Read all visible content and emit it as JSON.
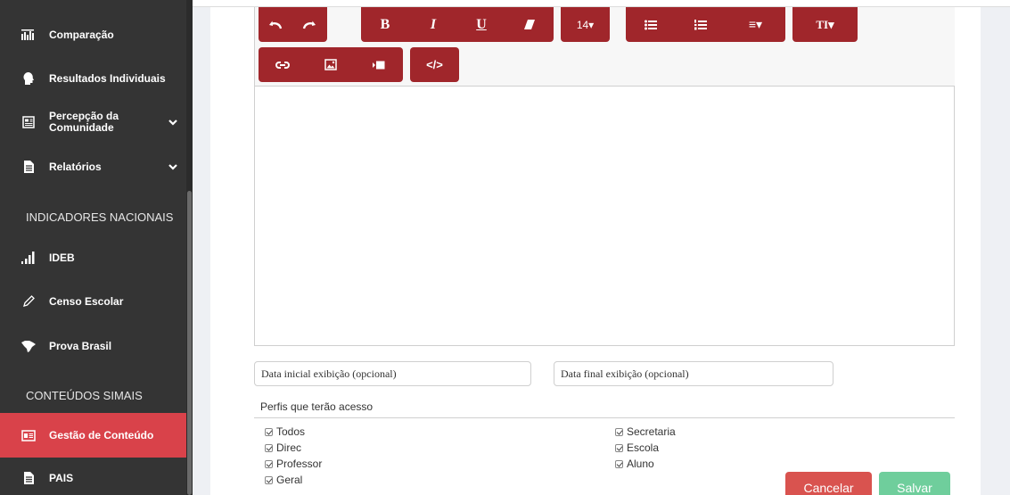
{
  "sidebar": {
    "items": [
      {
        "label": "Comparação",
        "icon": "bar-chart-icon"
      },
      {
        "label": "Resultados Individuais",
        "icon": "person-head-icon"
      },
      {
        "label_line1": "Percepção da",
        "label_line2": "Comunidade",
        "icon": "newspaper-icon"
      },
      {
        "label": "Relatórios",
        "icon": "document-icon"
      },
      {
        "label": "IDEB",
        "icon": "signal-bars-icon"
      },
      {
        "label": "Censo Escolar",
        "icon": "pencil-icon"
      },
      {
        "label": "Prova Brasil",
        "icon": "brazil-map-icon"
      },
      {
        "label": "Gestão de Conteúdo",
        "icon": "id-card-icon"
      },
      {
        "label": "PAIS",
        "icon": "document-icon"
      }
    ],
    "sections": {
      "nacionais": "INDICADORES NACIONAIS",
      "simais": "CONTEÚDOS SIMAIS"
    },
    "active_color": "#d9424a"
  },
  "toolbar": {
    "bold": "B",
    "italic": "I",
    "underline": "U",
    "font_size": "14▾",
    "align": "≡▾",
    "text_height": "TI▾",
    "code": "</>",
    "accent_color": "#a0262b"
  },
  "form": {
    "date_start_placeholder": "Data inicial exibição (opcional)",
    "date_end_placeholder": "Data final exibição (opcional)",
    "perfis_label": "Perfis que terão acesso",
    "profiles_left": [
      "Todos",
      "Direc",
      "Professor",
      "Geral"
    ],
    "profiles_right": [
      "Secretaria",
      "Escola",
      "Aluno"
    ],
    "cancel_label": "Cancelar",
    "save_label": "Salvar",
    "cancel_color": "#d9534f",
    "save_color": "#6fce9c"
  }
}
